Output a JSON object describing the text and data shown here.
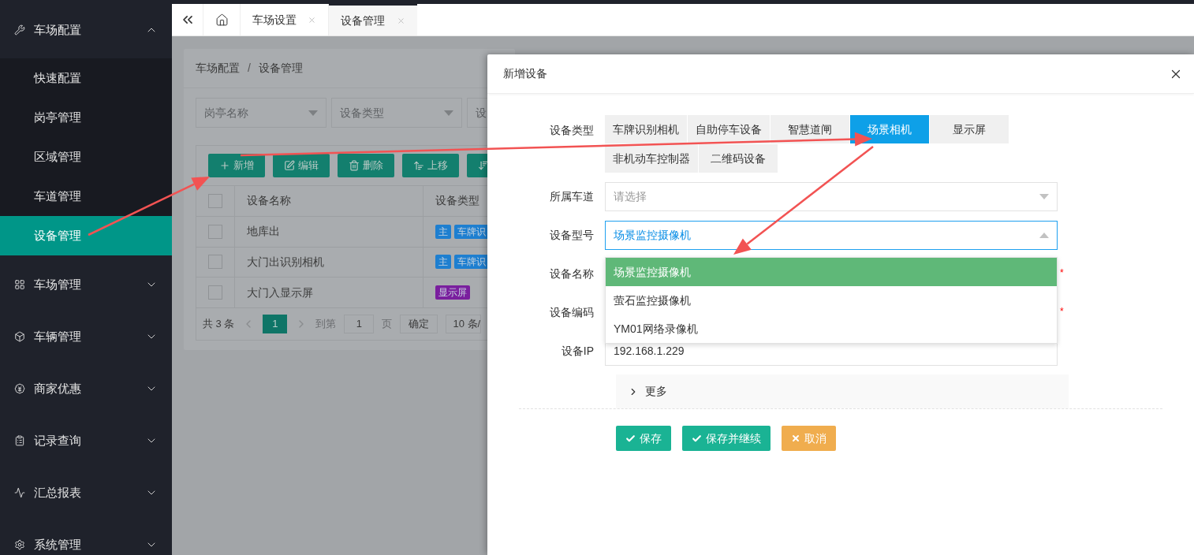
{
  "sidebar": {
    "items": [
      {
        "label": "车场配置",
        "expanded": true,
        "children": [
          {
            "label": "快速配置",
            "selected": false
          },
          {
            "label": "岗亭管理",
            "selected": false
          },
          {
            "label": "区域管理",
            "selected": false
          },
          {
            "label": "车道管理",
            "selected": false
          },
          {
            "label": "设备管理",
            "selected": true
          }
        ]
      },
      {
        "label": "车场管理",
        "expanded": false
      },
      {
        "label": "车辆管理",
        "expanded": false
      },
      {
        "label": "商家优惠",
        "expanded": false
      },
      {
        "label": "记录查询",
        "expanded": false
      },
      {
        "label": "汇总报表",
        "expanded": false
      },
      {
        "label": "系统管理",
        "expanded": false
      }
    ]
  },
  "tabs": [
    {
      "label": "车场设置",
      "selected": false
    },
    {
      "label": "设备管理",
      "selected": true
    }
  ],
  "page": {
    "breadcrumb": [
      "车场配置",
      "设备管理"
    ],
    "breadcrumb_separator": "/",
    "filters": [
      "岗亭名称",
      "设备类型",
      "设"
    ],
    "toolbar": [
      "新增",
      "编辑",
      "删除",
      "上移"
    ],
    "table": {
      "header_checked": false,
      "columns": [
        "设备名称",
        "设备类型"
      ],
      "rows": [
        {
          "checked": false,
          "name": "地库出",
          "tags": [
            {
              "label": "主",
              "color": "#1e7fd0"
            },
            {
              "label": "车牌识",
              "color": "#1e7fd0"
            }
          ]
        },
        {
          "checked": false,
          "name": "大门出识别相机",
          "tags": [
            {
              "label": "主",
              "color": "#1e7fd0"
            },
            {
              "label": "车牌识",
              "color": "#1e7fd0"
            }
          ]
        },
        {
          "checked": false,
          "name": "大门入显示屏",
          "tags": [
            {
              "label": "显示屏",
              "color": "#7a1f9e"
            }
          ]
        }
      ]
    },
    "pagination": {
      "total": "共 3 条",
      "current": "1",
      "goto": "到第",
      "goto_value": "1",
      "page_unit": "页",
      "confirm": "确定",
      "page_size": "10 条/"
    }
  },
  "modal": {
    "title": "新增设备",
    "fields": [
      {
        "kind": "choice",
        "label": "设备类型",
        "options": [
          {
            "label": "车牌识别相机",
            "selected": false
          },
          {
            "label": "自助停车设备",
            "selected": false
          },
          {
            "label": "智慧道闸",
            "selected": false
          },
          {
            "label": "场景相机",
            "selected": true
          },
          {
            "label": "显示屏",
            "selected": false
          },
          {
            "label": "非机动车控制器",
            "selected": false
          },
          {
            "label": "二维码设备",
            "selected": false
          }
        ]
      },
      {
        "kind": "select",
        "label": "所属车道",
        "placeholder": "请选择",
        "open": false
      },
      {
        "kind": "select",
        "label": "设备型号",
        "value": "场景监控摄像机",
        "open": true,
        "options": [
          {
            "label": "场景监控摄像机",
            "selected": true
          },
          {
            "label": "萤石监控摄像机",
            "selected": false
          },
          {
            "label": "YM01网络录像机",
            "selected": false
          }
        ]
      },
      {
        "kind": "text",
        "label": "设备名称",
        "required_mark": "*"
      },
      {
        "kind": "text",
        "label": "设备编码",
        "required_mark": "*"
      },
      {
        "kind": "text",
        "label": "设备IP",
        "value": "192.168.1.229"
      }
    ],
    "more": {
      "label": "更多",
      "expanded": false
    },
    "buttons": [
      {
        "label": "保存",
        "kind": "primary"
      },
      {
        "label": "保存并继续",
        "kind": "primary"
      },
      {
        "label": "取消",
        "kind": "warning"
      }
    ]
  }
}
